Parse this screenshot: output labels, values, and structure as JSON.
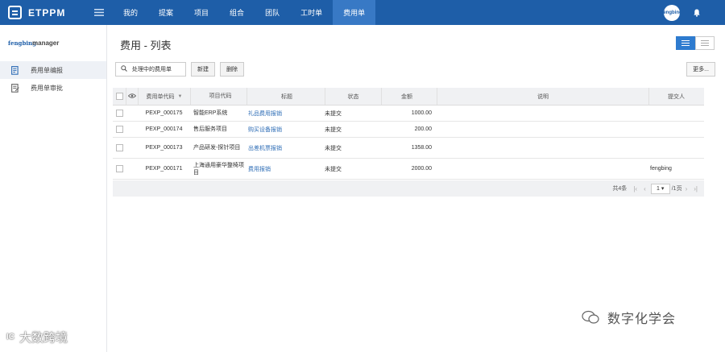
{
  "topbar": {
    "logo_text": "ETPPM",
    "nav": [
      "我的",
      "提案",
      "项目",
      "组合",
      "团队",
      "工时单",
      "费用单"
    ],
    "active_nav": "费用单",
    "avatar_text": "fengbing"
  },
  "sidebar": {
    "user": {
      "avatar_text": "fengbing",
      "name": "manager"
    },
    "items": [
      {
        "label": "费用单编报",
        "icon": "edit-doc-icon",
        "active": true
      },
      {
        "label": "费用单审批",
        "icon": "approve-doc-icon",
        "active": false
      }
    ]
  },
  "main": {
    "title": "费用 - 列表",
    "toolbar": {
      "search_label": "处理中的费用单",
      "new_label": "新建",
      "delete_label": "删除",
      "more_label": "更多..."
    },
    "table": {
      "headers": {
        "code": "费用单代码",
        "project": "项目代码",
        "title": "标题",
        "status": "状态",
        "amount": "金额",
        "desc": "说明",
        "submitter": "提交人"
      },
      "rows": [
        {
          "code": "PEXP_000175",
          "project": "智能ERP系统",
          "title": "礼品费用报销",
          "status": "未提交",
          "amount": "1000.00",
          "desc": "",
          "submitter": ""
        },
        {
          "code": "PEXP_000174",
          "project": "售后服务项目",
          "title": "购买设备报销",
          "status": "未提交",
          "amount": "200.00",
          "desc": "",
          "submitter": ""
        },
        {
          "code": "PEXP_000173",
          "project": "产品研发-探针项目",
          "title": "出差机票报销",
          "status": "未提交",
          "amount": "1358.00",
          "desc": "",
          "submitter": ""
        },
        {
          "code": "PEXP_000171",
          "project": "上海通用豪华整椅项目",
          "title": "费用报销",
          "status": "未提交",
          "amount": "2000.00",
          "desc": "",
          "submitter": "fengbing"
        }
      ]
    },
    "pager": {
      "total_label": "共4条",
      "current_page": "1",
      "page_total_label": "/1页"
    }
  },
  "watermarks": {
    "right": "数字化学会",
    "left_logo": "IC",
    "left": "大数跨境"
  }
}
